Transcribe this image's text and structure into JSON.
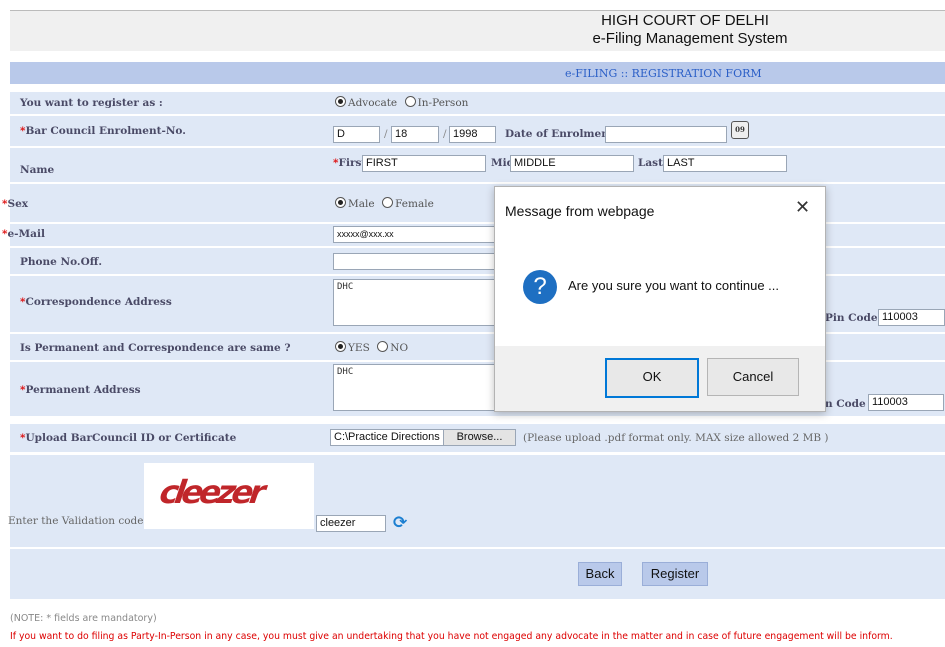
{
  "header": {
    "title_line1": "HIGH COURT OF DELHI",
    "title_line2": "e-Filing Management System"
  },
  "form": {
    "title": "e-FILING :: REGISTRATION FORM",
    "register_as": {
      "label": "You want to register as :",
      "options": [
        "Advocate",
        "In-Person"
      ],
      "selected": "Advocate"
    },
    "bar_council": {
      "label": "Bar Council Enrolment-No.",
      "part1": "D",
      "part2": "18",
      "part3": "1998",
      "date_label": "Date of Enrolment",
      "date_value": ""
    },
    "name": {
      "label": "Name",
      "first_label": "First",
      "first_value": "FIRST",
      "mid_label": "Mid",
      "mid_value": "MIDDLE",
      "last_label": "Last",
      "last_value": "LAST"
    },
    "sex": {
      "label": "Sex",
      "options": [
        "Male",
        "Female"
      ],
      "selected": "Male"
    },
    "email": {
      "label": "e-Mail",
      "value": "xxxxx@xxx.xx"
    },
    "phone": {
      "label": "Phone No.Off.",
      "value": ""
    },
    "corr_address": {
      "label": "Correspondence Address",
      "value": "DHC",
      "pin_label": "Pin Code",
      "pin_value": "110003"
    },
    "same_address": {
      "label": "Is Permanent and Correspondence are same ?",
      "options": [
        "YES",
        "NO"
      ],
      "selected": "YES"
    },
    "perm_address": {
      "label": "Permanent Address",
      "value": "DHC",
      "pin_label": "n Code",
      "pin_value": "110003"
    },
    "upload": {
      "label": "Upload BarCouncil ID or Certificate",
      "file_value": "C:\\Practice Directions",
      "browse_label": "Browse...",
      "hint": "(Please upload .pdf format only. MAX size allowed 2 MB )"
    },
    "validation": {
      "label": "Enter the Validation code :",
      "captcha_text": "cleezer",
      "input_value": "cleezer"
    },
    "buttons": {
      "back": "Back",
      "register": "Register"
    },
    "note": "(NOTE: * fields are mandatory)",
    "warning": "If you want to do filing as Party-In-Person in any case, you must give an undertaking that you have not engaged any advocate in the matter and in case of future engagement will be inform.",
    "required_mark": "*"
  },
  "dialog": {
    "title": "Message from webpage",
    "message": "Are you sure you want to continue ...",
    "ok_label": "OK",
    "cancel_label": "Cancel",
    "icon": "question-icon",
    "close_icon": "close-icon"
  },
  "colors": {
    "band": "#dfe8f6",
    "header_band": "#b9c9ea",
    "required": "#dd0000",
    "accent": "#0078d7"
  }
}
